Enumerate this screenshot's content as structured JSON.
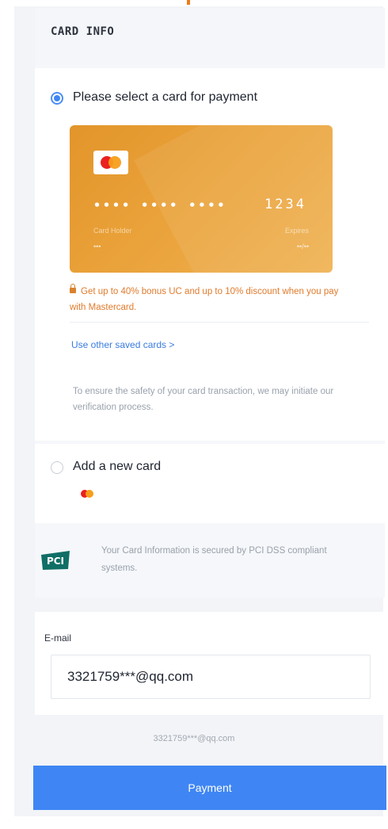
{
  "header": {
    "title": "CARD INFO"
  },
  "saved_card_option": {
    "label": "Please select a card for payment",
    "selected": true,
    "card": {
      "brand_icon": "mastercard-logo",
      "masked_groups": "•••• •••• ••••",
      "last4": "1234",
      "holder_label": "Card Holder",
      "holder_value": "•••",
      "expiry_label": "Expires",
      "expiry_value": "••/••",
      "color": "#e8a034"
    },
    "promo_icon": "lock-icon",
    "promo_text": "Get up to 40% bonus UC and up to 10% discount when you pay with Mastercard.",
    "other_cards_link": "Use other saved cards >",
    "safety_note": "To ensure the safety of your card transaction, we may initiate our verification process."
  },
  "new_card_option": {
    "label": "Add a new card",
    "selected": false,
    "brand_icon": "mastercard-logo"
  },
  "pci": {
    "logo_text": "PCI",
    "text": "Your Card Information is secured by PCI DSS compliant systems."
  },
  "email": {
    "label": "E-mail",
    "value": "3321759***@qq.com",
    "echo": "3321759***@qq.com"
  },
  "payment_button": {
    "label": "Payment",
    "color": "#3f86f4"
  },
  "colors": {
    "accent_orange": "#f07a1a",
    "link_blue": "#3a7be0",
    "promo_orange": "#e07b2c"
  }
}
